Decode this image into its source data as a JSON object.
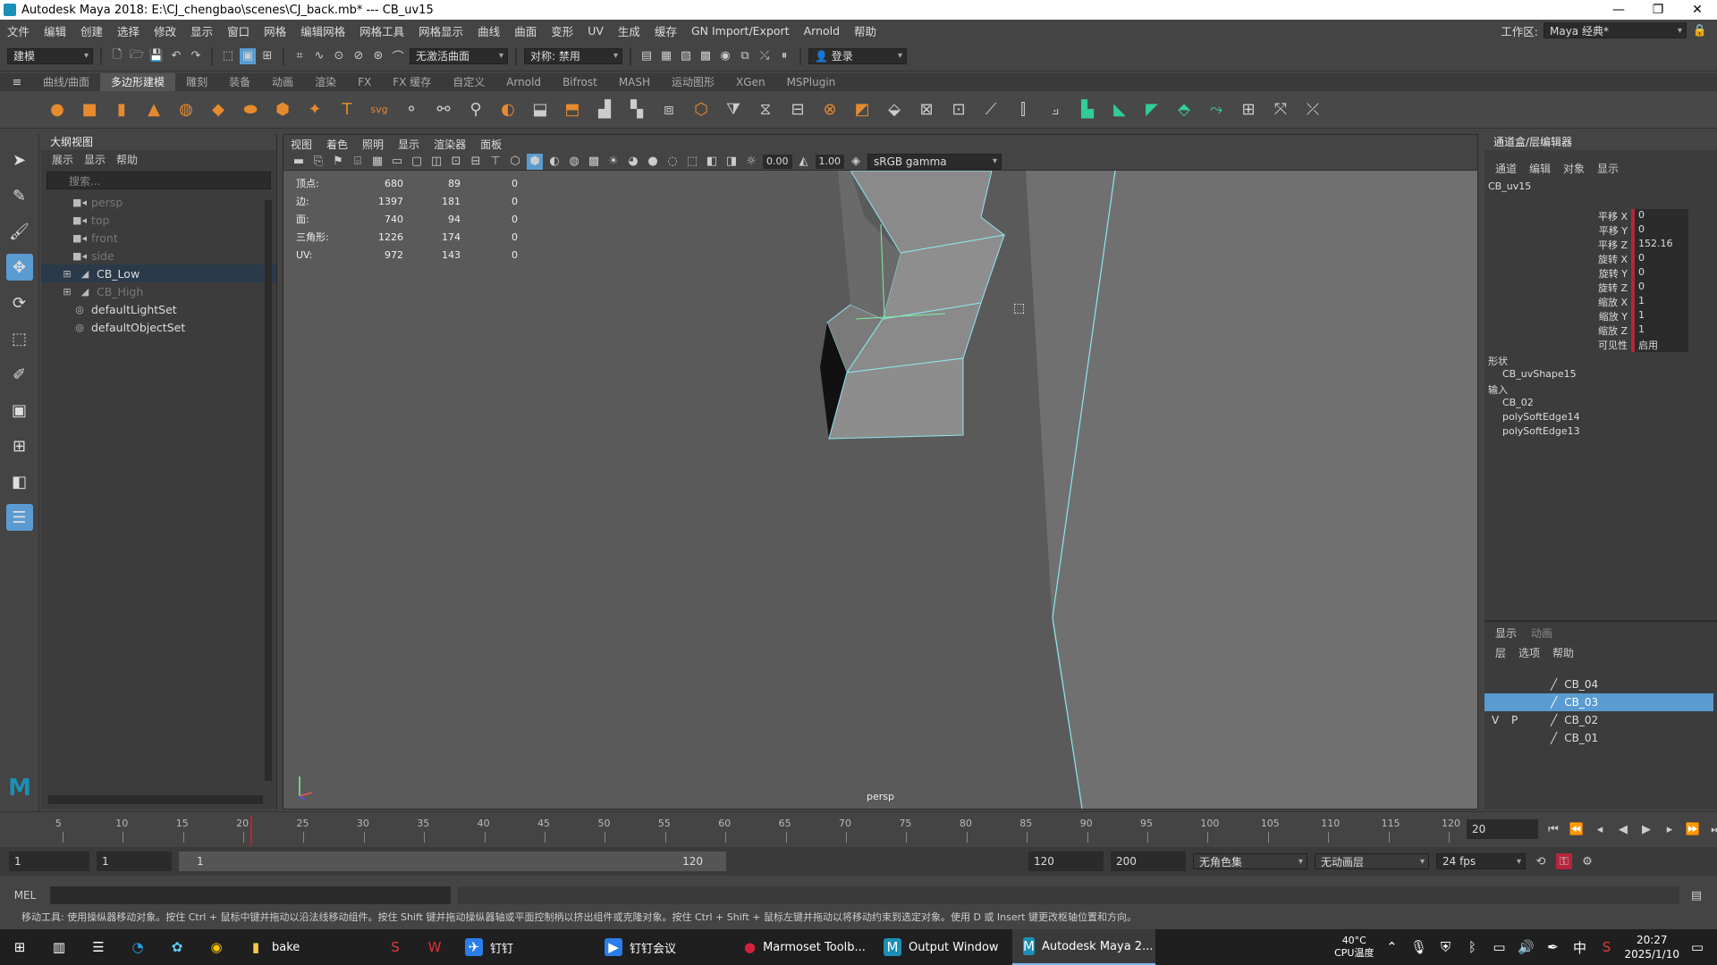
{
  "window": {
    "title": "Autodesk Maya 2018: E:\\CJ_chengbao\\scenes\\CJ_back.mb*   ---   CB_uv15",
    "minimize": "—",
    "maximize": "❐",
    "close": "✕"
  },
  "menubar": {
    "items": [
      "文件",
      "编辑",
      "创建",
      "选择",
      "修改",
      "显示",
      "窗口",
      "网格",
      "编辑网格",
      "网格工具",
      "网格显示",
      "曲线",
      "曲面",
      "变形",
      "UV",
      "生成",
      "缓存",
      "GN Import/Export",
      "Arnold",
      "帮助"
    ],
    "workspace_label": "工作区:",
    "workspace_value": "Maya 经典*"
  },
  "statusline": {
    "mode": "建模",
    "live_surface": "无激活曲面",
    "symmetry": "对称: 禁用",
    "login": "登录"
  },
  "shelf": {
    "tabs": [
      "曲线/曲面",
      "多边形建模",
      "雕刻",
      "装备",
      "动画",
      "渲染",
      "FX",
      "FX 缓存",
      "自定义",
      "Arnold",
      "Bifrost",
      "MASH",
      "运动图形",
      "XGen",
      "MSPlugin"
    ],
    "active_tab": 1
  },
  "outliner": {
    "title": "大纲视图",
    "menu": [
      "展示",
      "显示",
      "帮助"
    ],
    "search_placeholder": "搜索...",
    "items": [
      {
        "label": "persp",
        "type": "camera",
        "dim": true
      },
      {
        "label": "top",
        "type": "camera",
        "dim": true
      },
      {
        "label": "front",
        "type": "camera",
        "dim": true
      },
      {
        "label": "side",
        "type": "camera",
        "dim": true
      },
      {
        "label": "CB_Low",
        "type": "group",
        "dim": false,
        "selected": true
      },
      {
        "label": "CB_High",
        "type": "group",
        "dim": true
      },
      {
        "label": "defaultLightSet",
        "type": "set",
        "dim": false
      },
      {
        "label": "defaultObjectSet",
        "type": "set",
        "dim": false
      }
    ]
  },
  "viewport": {
    "menu": [
      "视图",
      "着色",
      "照明",
      "显示",
      "渲染器",
      "面板"
    ],
    "exposure": "0.00",
    "gamma": "1.00",
    "color_space": "sRGB gamma",
    "camera": "persp",
    "hud": [
      {
        "label": "顶点:",
        "a": "680",
        "b": "89",
        "c": "0"
      },
      {
        "label": "边:",
        "a": "1397",
        "b": "181",
        "c": "0"
      },
      {
        "label": "面:",
        "a": "740",
        "b": "94",
        "c": "0"
      },
      {
        "label": "三角形:",
        "a": "1226",
        "b": "174",
        "c": "0"
      },
      {
        "label": "UV:",
        "a": "972",
        "b": "143",
        "c": "0"
      }
    ]
  },
  "channelbox": {
    "title": "通道盒/层编辑器",
    "menu": [
      "通道",
      "编辑",
      "对象",
      "显示"
    ],
    "object": "CB_uv15",
    "attributes": [
      {
        "label": "平移 X",
        "value": "0"
      },
      {
        "label": "平移 Y",
        "value": "0"
      },
      {
        "label": "平移 Z",
        "value": "152.16"
      },
      {
        "label": "旋转 X",
        "value": "0"
      },
      {
        "label": "旋转 Y",
        "value": "0"
      },
      {
        "label": "旋转 Z",
        "value": "0"
      },
      {
        "label": "缩放 X",
        "value": "1"
      },
      {
        "label": "缩放 Y",
        "value": "1"
      },
      {
        "label": "缩放 Z",
        "value": "1"
      },
      {
        "label": "可见性",
        "value": "启用"
      }
    ],
    "shapes_label": "形状",
    "shape": "CB_uvShape15",
    "inputs_label": "输入",
    "inputs": [
      "CB_02",
      "polySoftEdge14",
      "polySoftEdge13"
    ]
  },
  "layers": {
    "tabs": [
      "显示",
      "动画"
    ],
    "menu": [
      "层",
      "选项",
      "帮助"
    ],
    "items": [
      {
        "name": "CB_04",
        "v": "",
        "p": "",
        "selected": false
      },
      {
        "name": "CB_03",
        "v": "",
        "p": "",
        "selected": true
      },
      {
        "name": "CB_02",
        "v": "V",
        "p": "P",
        "selected": false
      },
      {
        "name": "CB_01",
        "v": "",
        "p": "",
        "selected": false
      }
    ]
  },
  "timeline": {
    "ticks": [
      "5",
      "10",
      "15",
      "20",
      "25",
      "30",
      "35",
      "40",
      "45",
      "50",
      "55",
      "60",
      "65",
      "70",
      "75",
      "80",
      "85",
      "90",
      "95",
      "100",
      "105",
      "110",
      "115",
      "120"
    ],
    "current_frame": "20"
  },
  "range": {
    "start": "1",
    "playback_start": "1",
    "range_start": "1",
    "range_end": "120",
    "playback_end": "120",
    "end": "200",
    "character_set": "无角色集",
    "anim_layer": "无动画层",
    "fps": "24 fps"
  },
  "mel": {
    "label": "MEL"
  },
  "helpline": "移动工具: 使用操纵器移动对象。按住 Ctrl + 鼠标中键并拖动以沿法线移动组件。按住 Shift 键并拖动操纵器轴或平面控制柄以挤出组件或克隆对象。按住 Ctrl + Shift + 鼠标左键并拖动以将移动约束到选定对象。使用 D 或 Insert 键更改枢轴位置和方向。",
  "taskbar": {
    "tasks": [
      {
        "label": "bake",
        "icon": "folder-icon",
        "color": "#f2c94c",
        "active": false
      },
      {
        "label": "",
        "icon": "s-app-icon",
        "color": "#e23b3b",
        "active": false
      },
      {
        "label": "",
        "icon": "wps-icon",
        "color": "#d33",
        "active": false
      },
      {
        "label": "钉钉",
        "icon": "dingtalk-icon",
        "color": "#2b7de9",
        "active": false
      },
      {
        "label": "钉钉会议",
        "icon": "meeting-icon",
        "color": "#2b7de9",
        "active": false
      },
      {
        "label": "Marmoset Toolb...",
        "icon": "marmoset-icon",
        "color": "#d0223a",
        "active": false
      },
      {
        "label": "Output Window",
        "icon": "maya-icon",
        "color": "#1b8fb5",
        "active": false
      },
      {
        "label": "Autodesk Maya 2...",
        "icon": "maya-icon",
        "color": "#1b8fb5",
        "active": true
      }
    ],
    "temp": "40°C",
    "temp_label": "CPU温度",
    "ime": "中",
    "time": "20:27",
    "date": "2025/1/10"
  }
}
